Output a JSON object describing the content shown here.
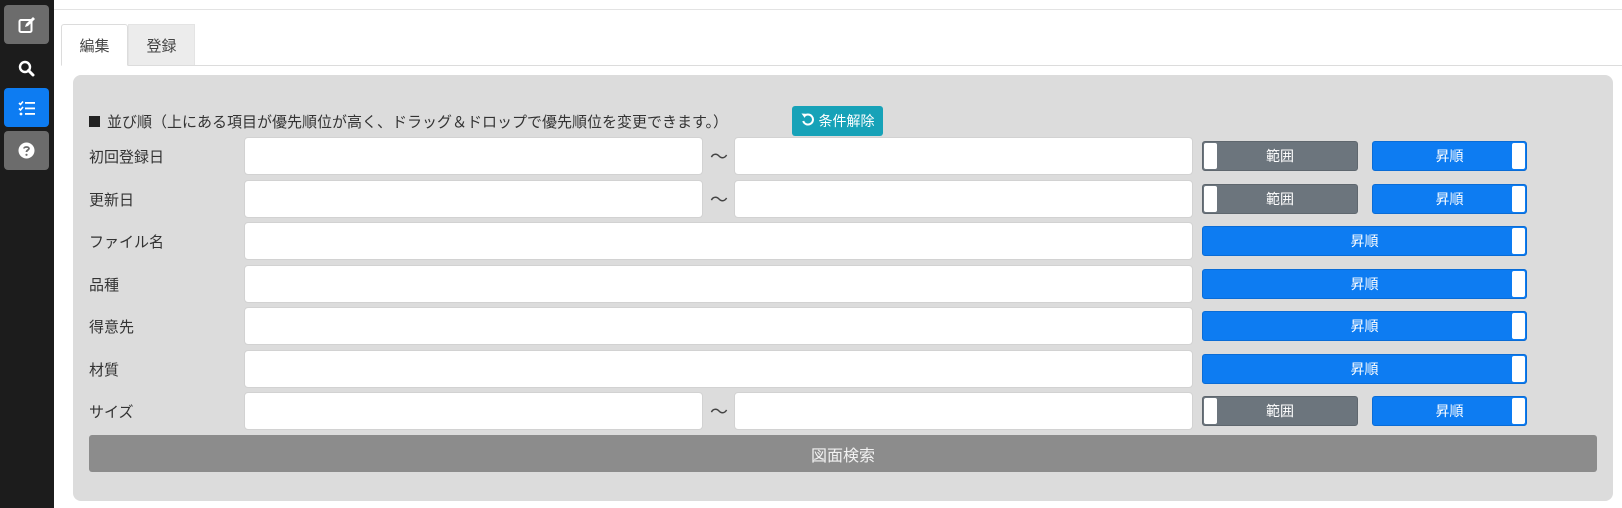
{
  "sidebar": {
    "items": [
      {
        "icon": "edit-icon",
        "active": false
      },
      {
        "icon": "search-icon",
        "active": false
      },
      {
        "icon": "list-check-icon",
        "active": true
      },
      {
        "icon": "help-icon",
        "active": false
      }
    ]
  },
  "tabs": [
    {
      "label": "編集",
      "active": true
    },
    {
      "label": "登録",
      "active": false
    }
  ],
  "sort": {
    "header": "並び順（上にある項目が優先順位が高く、ドラッグ＆ドロップで優先順位を変更できます。）",
    "reset_label": "条件解除"
  },
  "range_label": "範囲",
  "order_label": "昇順",
  "tilde": "～",
  "rows": [
    {
      "label": "初回登録日",
      "from": "",
      "to": "",
      "type": "range"
    },
    {
      "label": "更新日",
      "from": "",
      "to": "",
      "type": "range"
    },
    {
      "label": "ファイル名",
      "value": "",
      "type": "text"
    },
    {
      "label": "品種",
      "value": "",
      "type": "text"
    },
    {
      "label": "得意先",
      "value": "",
      "type": "text"
    },
    {
      "label": "材質",
      "value": "",
      "type": "text"
    },
    {
      "label": "サイズ",
      "from": "",
      "to": "",
      "type": "range"
    }
  ],
  "search_button": "図面検索",
  "colors": {
    "sidebar_bg": "#1c1c1c",
    "active_blue": "#0d7cf2",
    "teal": "#17a2b8",
    "gray_toggle": "#6c757d",
    "panel_bg": "#dcdcdc",
    "search_btn": "#8c8c8c"
  }
}
